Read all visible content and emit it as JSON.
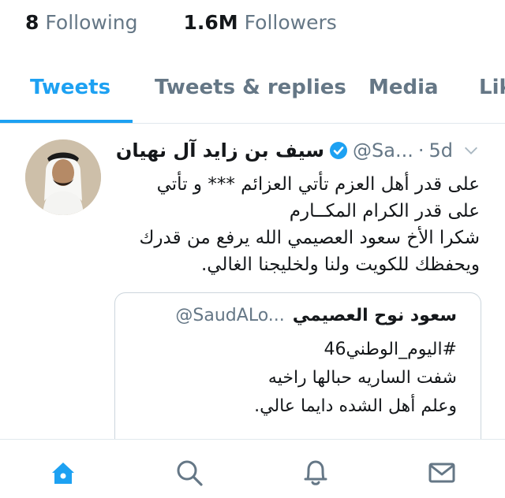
{
  "profile_stats": {
    "following_count": "8",
    "following_label": "Following",
    "followers_count": "1.6M",
    "followers_label": "Followers"
  },
  "tabs": [
    {
      "label": "Tweets",
      "active": true
    },
    {
      "label": "Tweets & replies",
      "active": false
    },
    {
      "label": "Media",
      "active": false
    },
    {
      "label": "Lik",
      "active": false
    }
  ],
  "tweet": {
    "author_name": "سيف بن زايد آل نهيان",
    "handle": "@Sa...",
    "separator": "·",
    "time": "5d",
    "lines": [
      "على قدر أهل العزم تأتي العزائم *** و تأتي",
      "على قدر الكرام المكــارم",
      "شكرا الأخ سعود العصيمي الله يرفع من قدرك",
      "ويحفظك للكويت ولنا ولخليجنا الغالي."
    ],
    "quoted": {
      "author_name": "سعود نوح العصيمي",
      "handle": "@SaudALo...",
      "lines": [
        "#اليوم_الوطني46",
        "شفت  الساريه حبالها راخيه",
        "وعلم أهل الشده دايما عالي."
      ]
    }
  },
  "nav": {
    "items": [
      "home-icon",
      "search-icon",
      "notifications-icon",
      "messages-icon"
    ],
    "active_color": "#1da1f2",
    "inactive_color": "#657786"
  },
  "colors": {
    "accent": "#1da1f2",
    "secondary_text": "#657786",
    "border": "#e1e8ed"
  }
}
